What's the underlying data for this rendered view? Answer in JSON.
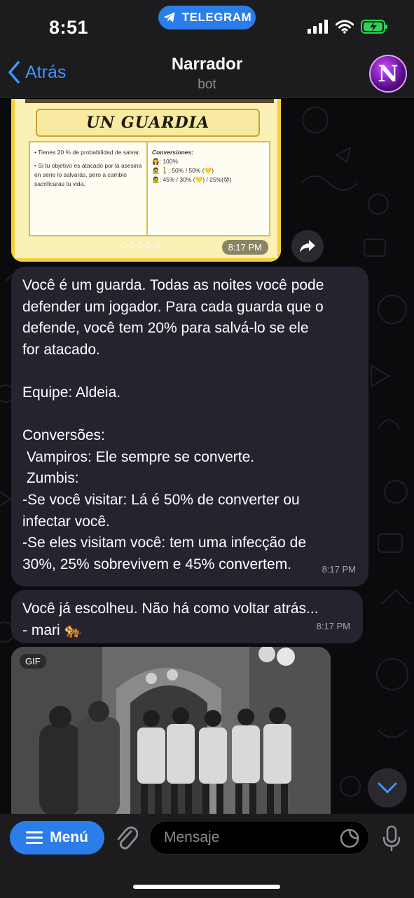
{
  "status": {
    "time": "8:51",
    "app_pill": "TELEGRAM",
    "icons": [
      "signal-icon",
      "wifi-icon",
      "battery-charging-icon"
    ],
    "accent": "#2b7de9"
  },
  "header": {
    "back_label": "Atrás",
    "title": "Narrador",
    "subtitle": "bot",
    "avatar_letter": "N"
  },
  "card": {
    "title": "UN GUARDIA",
    "left_lines": [
      "• Tienes 20 % de probabilidad de salvar.",
      "• Si tu objetivo es atacado por la asesina en serie lo salvarás, pero a cambio sacrificarás tu vida."
    ],
    "right_heading": "Conversiones:",
    "right_lines": [
      "🧛: 100%",
      "🧟 🚶: 50% / 50% (💛)",
      "🧟: 45% / 30% (💛) / 25%(😵)"
    ],
    "diamonds": "◇◇◇◇◇",
    "time": "8:17 PM"
  },
  "messages": [
    {
      "text": "Você é um guarda. Todas as noites você pode\ndefender um jogador. Para cada guarda que o\ndefende, você tem 20% para salvá-lo se ele\nfor atacado.\n\nEquipe: Aldeia.\n\nConversões:\n Vampiros: Ele sempre se converte.\n Zumbis:\n-Se você visitar: Lá é 50% de converter ou\ninfectar você.\n-Se eles visitam você: tem uma infecção de\n30%, 25% sobrevivem e 45% convertem.",
      "time": "8:17 PM"
    },
    {
      "text": "Você já escolheu. Não há como voltar atrás...\n- mari 🐅",
      "time": "8:17 PM"
    }
  ],
  "gif": {
    "badge": "GIF"
  },
  "input": {
    "menu_label": "Menú",
    "placeholder": "Mensaje"
  }
}
